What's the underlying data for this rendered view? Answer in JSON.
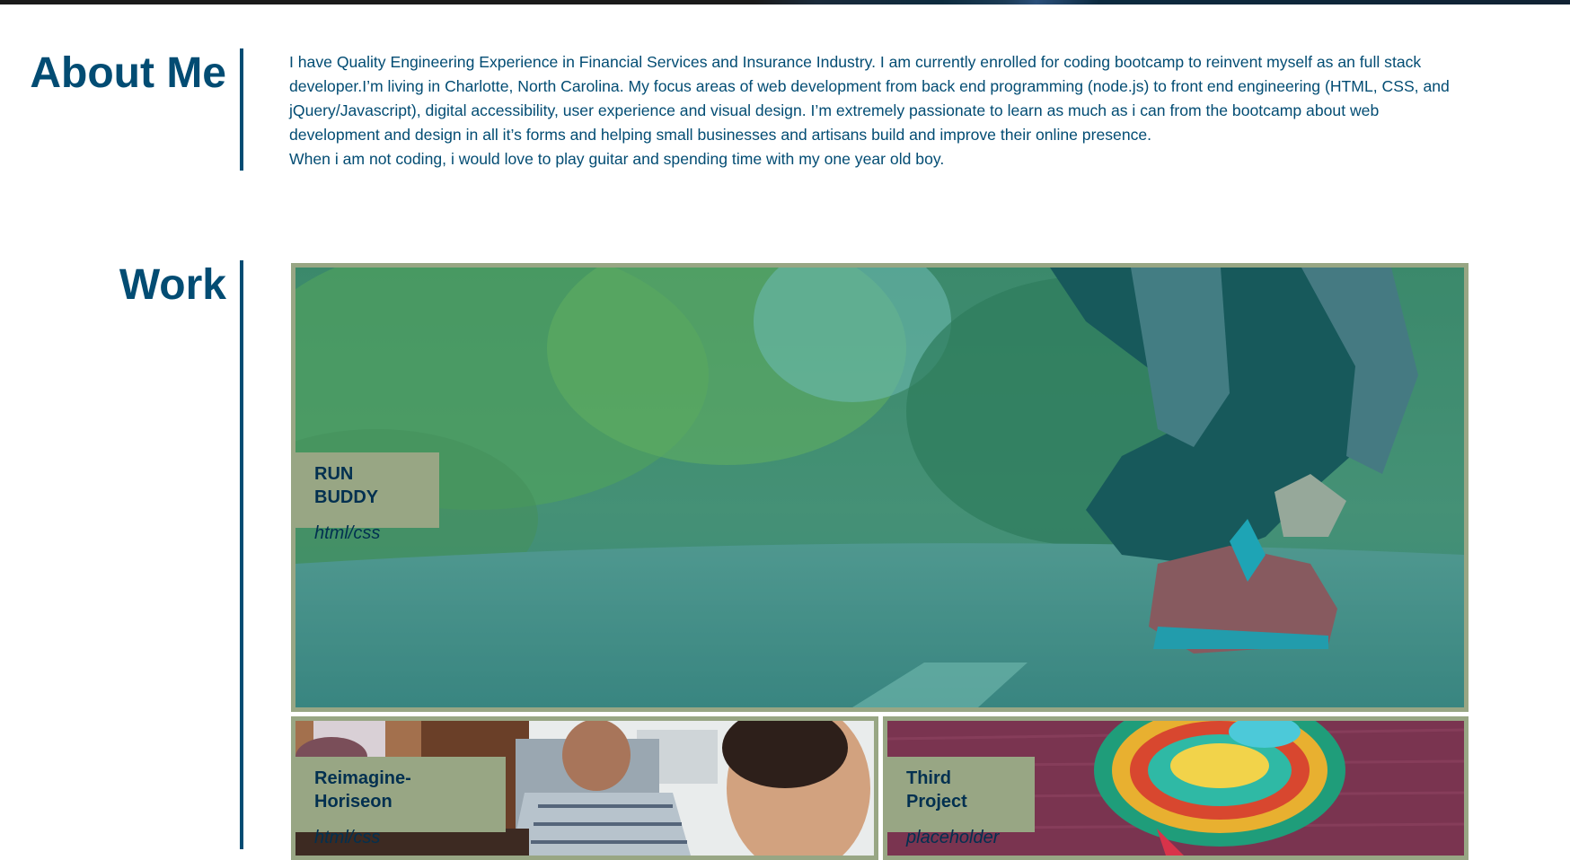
{
  "about": {
    "title": "About Me",
    "paragraph1": "I have Quality Engineering Experience in Financial Services and Insurance Industry. I am currently enrolled for coding bootcamp to reinvent myself as an full stack developer.I’m living in Charlotte, North Carolina. My focus areas of web development from back end programming (node.js) to front end engineering (HTML, CSS, and jQuery/Javascript), digital accessibility, user experience and visual design. I’m extremely passionate to learn as much as i can from the bootcamp about web development and design in all it’s forms and helping small businesses and artisans build and improve their online presence.",
    "paragraph2": "When i am not coding, i would love to play guitar and spending time with my one year old boy."
  },
  "work": {
    "title": "Work",
    "projects": [
      {
        "name": "RUN BUDDY",
        "tech": "html/css"
      },
      {
        "name": "Reimagine-Horiseon",
        "tech": "html/css"
      },
      {
        "name": "Third Project",
        "tech": "placeholder"
      }
    ]
  },
  "colors": {
    "heading": "#024c73",
    "accent": "#98a684",
    "text": "#024c73"
  }
}
